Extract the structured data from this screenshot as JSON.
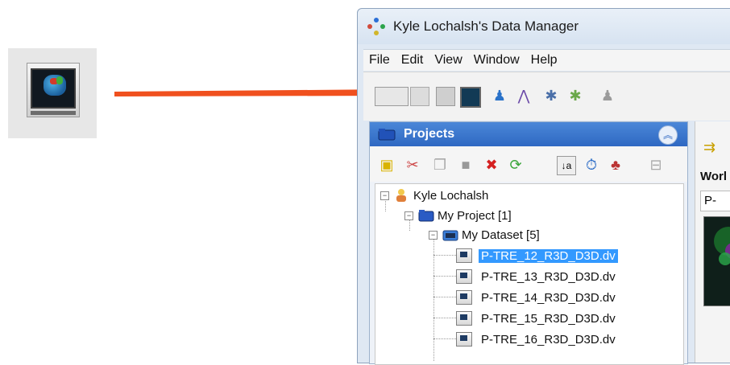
{
  "window": {
    "title": "Kyle Lochalsh's Data Manager"
  },
  "menu": [
    "File",
    "Edit",
    "View",
    "Window",
    "Help"
  ],
  "projects_panel": {
    "title": "Projects"
  },
  "tree": {
    "user": "Kyle Lochalsh",
    "project": "My Project [1]",
    "dataset": "My Dataset [5]",
    "files": [
      "P-TRE_12_R3D_D3D.dv",
      "P-TRE_13_R3D_D3D.dv",
      "P-TRE_14_R3D_D3D.dv",
      "P-TRE_15_R3D_D3D.dv",
      "P-TRE_16_R3D_D3D.dv"
    ],
    "selected_index": 0
  },
  "right_pane": {
    "work_label": "Worl",
    "tab_label": "P-"
  },
  "colors": {
    "arrow": "#f0501e",
    "panel_header": "#3a77cf",
    "selection": "#3399ff"
  },
  "icons": {
    "zoomed": "image-viewer-icon"
  }
}
